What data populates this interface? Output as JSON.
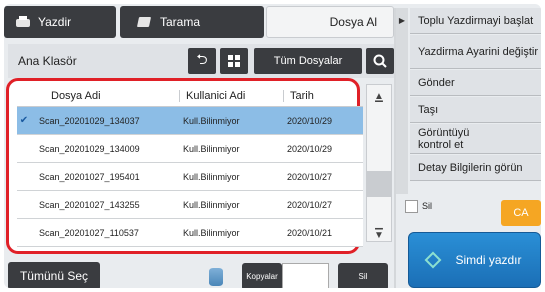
{
  "tabs": [
    {
      "label": "Yazdir",
      "icon": "printer-icon"
    },
    {
      "label": "Tarama",
      "icon": "scan-icon"
    },
    {
      "label": "Dosya Al"
    }
  ],
  "header": {
    "folder_title": "Ana Klasör",
    "all_files_label": "Tüm Dosyalar"
  },
  "table": {
    "columns": [
      "Dosya Adi",
      "Kullanici Adi",
      "Tarih"
    ],
    "rows": [
      {
        "selected": true,
        "name": "Scan_20201029_134037",
        "user": "Kull.Bilinmiyor",
        "date": "2020/10/29"
      },
      {
        "selected": false,
        "name": "Scan_20201029_134009",
        "user": "Kull.Bilinmiyor",
        "date": "2020/10/29"
      },
      {
        "selected": false,
        "name": "Scan_20201027_195401",
        "user": "Kull.Bilinmiyor",
        "date": "2020/10/27"
      },
      {
        "selected": false,
        "name": "Scan_20201027_143255",
        "user": "Kull.Bilinmiyor",
        "date": "2020/10/27"
      },
      {
        "selected": false,
        "name": "Scan_20201027_110537",
        "user": "Kull.Bilinmiyor",
        "date": "2020/10/21"
      }
    ]
  },
  "bottom": {
    "select_all_label": "Tümünü Seç",
    "copies_label": "Kopyalar",
    "delete_label": "Sil"
  },
  "side_menu": [
    "Toplu Yazdirmayi başlat",
    "Yazdirma Ayarini değiştir",
    "Gönder",
    "Taşı",
    "Görüntüyü kontrol et",
    "Detay Bilgilerin görün"
  ],
  "side_bottom": {
    "delete_label": "Sil",
    "ca_label": "CA",
    "start_label": "Simdi yazdır"
  },
  "colors": {
    "highlight_border": "#e02027",
    "selected_row": "#8cbde6",
    "start_button": "#1b6fb6",
    "ca_button": "#f5a623"
  }
}
